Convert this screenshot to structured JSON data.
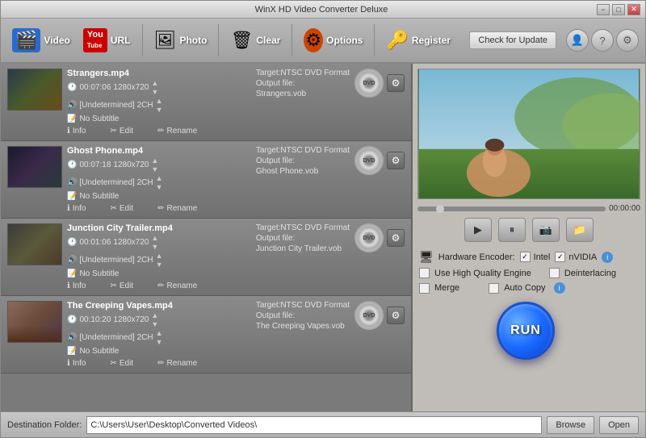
{
  "window": {
    "title": "WinX HD Video Converter Deluxe",
    "controls": {
      "minimize": "−",
      "maximize": "□",
      "close": "✕"
    }
  },
  "toolbar": {
    "buttons": [
      {
        "id": "video",
        "label": "Video",
        "icon": "🎬"
      },
      {
        "id": "url",
        "label": "URL",
        "icon": "📺"
      },
      {
        "id": "photo",
        "label": "Photo",
        "icon": "🖼"
      },
      {
        "id": "clear",
        "label": "Clear",
        "icon": "🗑"
      },
      {
        "id": "options",
        "label": "Options",
        "icon": "⚙"
      },
      {
        "id": "register",
        "label": "Register",
        "icon": "🔑"
      }
    ],
    "check_update": "Check for Update"
  },
  "files": [
    {
      "name": "Strangers.mp4",
      "duration": "00:07:06",
      "resolution": "1280x720",
      "audio": "[Undetermined] 2CH",
      "subtitle": "No Subtitle",
      "target": "Target:NTSC DVD Format",
      "output_label": "Output file:",
      "output_file": "Strangers.vob",
      "thumb_class": "file-thumb-1"
    },
    {
      "name": "Ghost Phone.mp4",
      "duration": "00:07:18",
      "resolution": "1280x720",
      "audio": "[Undetermined] 2CH",
      "subtitle": "No Subtitle",
      "target": "Target:NTSC DVD Format",
      "output_label": "Output file:",
      "output_file": "Ghost Phone.vob",
      "thumb_class": "file-thumb-2"
    },
    {
      "name": "Junction City Trailer.mp4",
      "duration": "00:01:06",
      "resolution": "1280x720",
      "audio": "[Undetermined] 2CH",
      "subtitle": "No Subtitle",
      "target": "Target:NTSC DVD Format",
      "output_label": "Output file:",
      "output_file": "Junction City Trailer.vob",
      "thumb_class": "file-thumb-3"
    },
    {
      "name": "The Creeping Vapes.mp4",
      "duration": "00:10:20",
      "resolution": "1280x720",
      "audio": "[Undetermined] 2CH",
      "subtitle": "No Subtitle",
      "target": "Target:NTSC DVD Format",
      "output_label": "Output file:",
      "output_file": "The Creeping Vapes.vob",
      "thumb_class": "file-thumb-4"
    }
  ],
  "preview": {
    "time": "00:00:00",
    "controls": {
      "play": "▶",
      "pause": "⏸",
      "screenshot": "📷",
      "folder": "📁"
    }
  },
  "options": {
    "hardware_encoder_label": "Hardware Encoder:",
    "intel_label": "Intel",
    "nvidia_label": "nVIDIA",
    "high_quality_label": "Use High Quality Engine",
    "deinterlacing_label": "Deinterlacing",
    "merge_label": "Merge",
    "auto_copy_label": "Auto Copy"
  },
  "actions": {
    "info": "Info",
    "edit": "Edit",
    "rename": "Rename"
  },
  "bottom": {
    "dest_label": "Destination Folder:",
    "dest_path": "C:\\Users\\User\\Desktop\\Converted Videos\\",
    "browse_btn": "Browse",
    "open_btn": "Open"
  },
  "run_btn": "RUN"
}
